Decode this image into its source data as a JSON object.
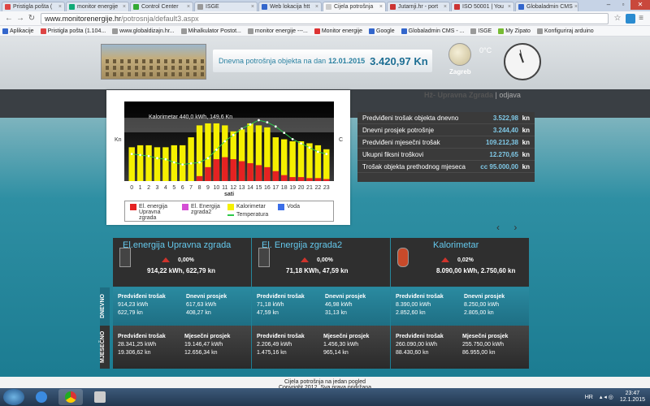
{
  "browser": {
    "tabs": [
      {
        "label": "Pristigla pošta (",
        "fav": "#d44"
      },
      {
        "label": "monitor energije",
        "fav": "#1a7"
      },
      {
        "label": "Control Center",
        "fav": "#3a3"
      },
      {
        "label": "ISGE",
        "fav": "#999"
      },
      {
        "label": "Web lokacija htt",
        "fav": "#36c"
      },
      {
        "label": "Cijela potrošnja",
        "fav": "#ccc"
      },
      {
        "label": "Jutarnji.hr - port",
        "fav": "#c33"
      },
      {
        "label": "ISO 50001 | You",
        "fav": "#c33"
      },
      {
        "label": "Globaladmin CMS",
        "fav": "#36c"
      }
    ],
    "url_host": "www.monitorenergije.hr",
    "url_path": "/potrosnja/default3.aspx",
    "bookmarks": [
      {
        "label": "Aplikacije",
        "color": "#36c"
      },
      {
        "label": "Pristigla pošta (1.104...",
        "color": "#d44"
      },
      {
        "label": "www.globaldizajn.hr...",
        "color": "#999"
      },
      {
        "label": "Mihalkulator Postot...",
        "color": "#999"
      },
      {
        "label": "monitor energije ---...",
        "color": "#999"
      },
      {
        "label": "Monitor energije",
        "color": "#d33"
      },
      {
        "label": "Google",
        "color": "#36c"
      },
      {
        "label": "Globaladmin CMS - ...",
        "color": "#36c"
      },
      {
        "label": "ISGE",
        "color": "#999"
      },
      {
        "label": "My Zipato",
        "color": "#7b3"
      },
      {
        "label": "Konfiguriraj arduino",
        "color": "#999"
      }
    ]
  },
  "header": {
    "label": "Dnevna potrošnja objekta na dan",
    "date": "12.01.2015",
    "value": "3.420,97 Kn",
    "temperature": "0°C",
    "city": "Zagreb"
  },
  "building": {
    "name": "Hž- Upravna Zgrada",
    "separator": "|",
    "logout": "odjava"
  },
  "chart_data": {
    "type": "bar",
    "xlabel": "sati",
    "left_axis": "Kn",
    "right_axis": "C",
    "categories": [
      "0",
      "1",
      "2",
      "3",
      "4",
      "5",
      "6",
      "7",
      "8",
      "9",
      "10",
      "11",
      "12",
      "13",
      "14",
      "15",
      "16",
      "17",
      "18",
      "19",
      "20",
      "21",
      "22",
      "23"
    ],
    "tooltip": "Kalorimetar 440,0 kWh, 149,6 Kn",
    "series": [
      {
        "name": "El. energija Upravna zgrada",
        "color": "#e52222",
        "values": [
          0,
          0,
          0,
          0,
          0,
          0,
          0,
          0,
          5,
          14,
          22,
          24,
          22,
          20,
          18,
          16,
          14,
          10,
          6,
          4,
          4,
          3,
          3,
          2
        ]
      },
      {
        "name": "El. Energija zgrada2",
        "color": "#d44ed4",
        "values": [
          0,
          0,
          0,
          0,
          0,
          0,
          0,
          0,
          0,
          0,
          0,
          0,
          0,
          0,
          0,
          0,
          0,
          0,
          0,
          0,
          0,
          0,
          0,
          0
        ]
      },
      {
        "name": "Kalorimetar",
        "color": "#f5f000",
        "values": [
          34,
          36,
          36,
          34,
          34,
          36,
          36,
          44,
          56,
          58,
          58,
          56,
          50,
          52,
          58,
          56,
          54,
          44,
          42,
          40,
          40,
          38,
          36,
          32
        ]
      },
      {
        "name": "Voda",
        "color": "#3b6ee8",
        "values": [
          0,
          0,
          0,
          0,
          0,
          0,
          0,
          0,
          0,
          0,
          0,
          0,
          0,
          0,
          0,
          0,
          0,
          0,
          0,
          0,
          0,
          0,
          0,
          0
        ]
      },
      {
        "name": "Temperatura",
        "color": "#2ec84a",
        "values": [
          18,
          17,
          16,
          14,
          13,
          10,
          8,
          9,
          10,
          14,
          22,
          30,
          36,
          42,
          46,
          50,
          48,
          44,
          38,
          32,
          28,
          24,
          20,
          18
        ]
      }
    ]
  },
  "summary": {
    "rows": [
      {
        "label": "Predviđeni trošak objekta dnevno",
        "value": "3.522,98",
        "unit": "kn"
      },
      {
        "label": "Dnevni prosjek potrošnje",
        "value": "3.244,40",
        "unit": "kn"
      },
      {
        "label": "Predviđeni mjesečni trošak",
        "value": "109.212,38",
        "unit": "kn"
      },
      {
        "label": "Ukupni fiksni troškovi",
        "value": "12.270,65",
        "unit": "kn"
      },
      {
        "label": "Trošak objekta prethodnog mjeseca",
        "value": "cc 95.000,00",
        "unit": "kn"
      }
    ]
  },
  "side_labels": {
    "daily": "DNEVNO",
    "monthly": "MJESEČNO"
  },
  "meters": [
    {
      "title": "El.energija Upravna zgrada",
      "pct": "0,00%",
      "value": "914,22 kWh, 622,79 kn",
      "daily_pred_label": "Predviđeni trošak",
      "daily_pred_1": "914,23 kWh",
      "daily_pred_2": "622,79 kn",
      "daily_avg_label": "Dnevni prosjek",
      "daily_avg_1": "617,63 kWh",
      "daily_avg_2": "408,27 kn",
      "monthly_pred_label": "Predviđeni trošak",
      "monthly_pred_1": "28.341,25 kWh",
      "monthly_pred_2": "19.306,62 kn",
      "monthly_avg_label": "Mjesečni prosjek",
      "monthly_avg_1": "19.146,47 kWh",
      "monthly_avg_2": "12.656,34 kn"
    },
    {
      "title": "El. Energija zgrada2",
      "pct": "0,00%",
      "value": "71,18 KWh, 47,59 kn",
      "daily_pred_label": "Predviđeni trošak",
      "daily_pred_1": "71,18 kWh",
      "daily_pred_2": "47,59 kn",
      "daily_avg_label": "Dnevni prosjek",
      "daily_avg_1": "46,98 kWh",
      "daily_avg_2": "31,13 kn",
      "monthly_pred_label": "Predviđeni trošak",
      "monthly_pred_1": "2.206,49 kWh",
      "monthly_pred_2": "1.475,16 kn",
      "monthly_avg_label": "Mjesečni prosjek",
      "monthly_avg_1": "1.456,30 kWh",
      "monthly_avg_2": "965,14 kn"
    },
    {
      "title": "Kalorimetar",
      "pct": "0,02%",
      "value": "8.090,00 kWh, 2.750,60 kn",
      "daily_pred_label": "Predviđeni trošak",
      "daily_pred_1": "8.390,00 kWh",
      "daily_pred_2": "2.852,60 kn",
      "daily_avg_label": "Dnevni prosjek",
      "daily_avg_1": "8.250,00 kWh",
      "daily_avg_2": "2.805,00 kn",
      "monthly_pred_label": "Predviđeni trošak",
      "monthly_pred_1": "260.090,00 kWh",
      "monthly_pred_2": "88.430,60 kn",
      "monthly_avg_label": "Mjesečni prosjek",
      "monthly_avg_1": "255.750,00 kWh",
      "monthly_avg_2": "86.955,00 kn"
    }
  ],
  "footer": {
    "line1": "Cijela potrošnja na jedan pogled",
    "line2": "Copyright 2012. Sva prava pridržana"
  },
  "taskbar": {
    "lang": "HR",
    "time": "23:47",
    "date": "12.1.2015"
  }
}
